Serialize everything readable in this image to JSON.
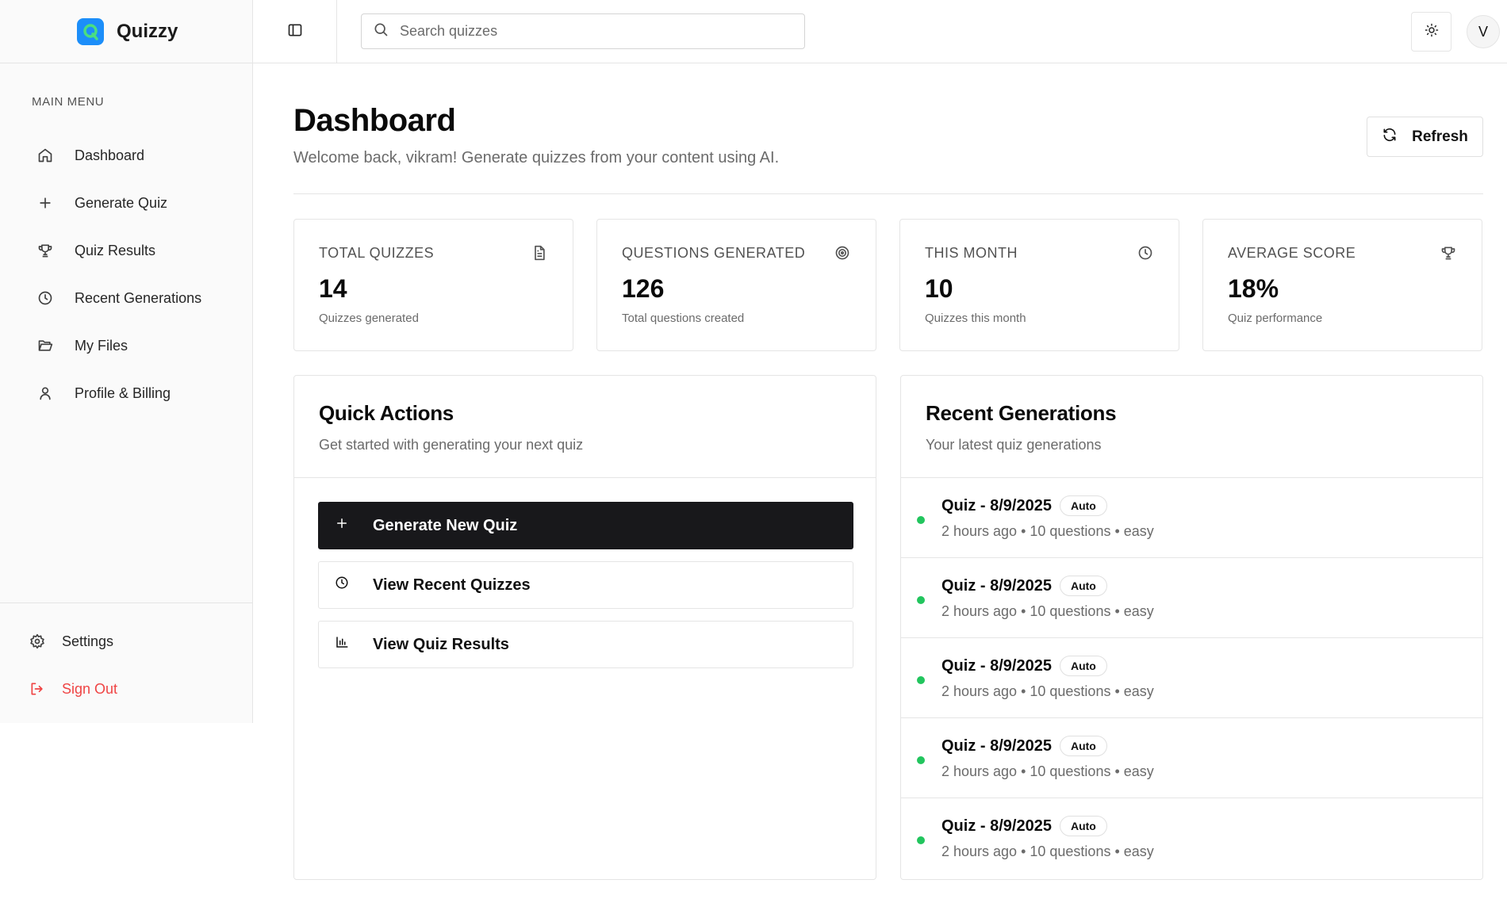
{
  "brand": {
    "name": "Quizzy",
    "logo_letter": "Q"
  },
  "search": {
    "placeholder": "Search quizzes",
    "value": ""
  },
  "user": {
    "avatar_initial": "V"
  },
  "sidebar": {
    "heading": "MAIN MENU",
    "items": [
      {
        "label": "Dashboard",
        "icon": "home-icon"
      },
      {
        "label": "Generate Quiz",
        "icon": "plus-icon"
      },
      {
        "label": "Quiz Results",
        "icon": "trophy-icon"
      },
      {
        "label": "Recent Generations",
        "icon": "clock-icon"
      },
      {
        "label": "My Files",
        "icon": "folder-open-icon"
      },
      {
        "label": "Profile & Billing",
        "icon": "user-icon"
      }
    ],
    "bottom": {
      "settings_label": "Settings",
      "signout_label": "Sign Out"
    }
  },
  "header": {
    "title": "Dashboard",
    "subtitle": "Welcome back, vikram! Generate quizzes from your content using AI.",
    "refresh_label": "Refresh"
  },
  "stats": [
    {
      "label": "TOTAL QUIZZES",
      "value": "14",
      "desc": "Quizzes generated",
      "icon": "file-text-icon"
    },
    {
      "label": "QUESTIONS GENERATED",
      "value": "126",
      "desc": "Total questions created",
      "icon": "target-icon"
    },
    {
      "label": "THIS MONTH",
      "value": "10",
      "desc": "Quizzes this month",
      "icon": "clock-icon"
    },
    {
      "label": "AVERAGE SCORE",
      "value": "18%",
      "desc": "Quiz performance",
      "icon": "trophy-icon"
    }
  ],
  "quick_actions": {
    "title": "Quick Actions",
    "subtitle": "Get started with generating your next quiz",
    "buttons": [
      {
        "label": "Generate New Quiz",
        "icon": "plus-icon"
      },
      {
        "label": "View Recent Quizzes",
        "icon": "clock-icon"
      },
      {
        "label": "View Quiz Results",
        "icon": "bar-chart-icon"
      }
    ]
  },
  "recent": {
    "title": "Recent Generations",
    "subtitle": "Your latest quiz generations",
    "items": [
      {
        "title": "Quiz - 8/9/2025",
        "badge": "Auto",
        "meta": "2 hours ago • 10 questions • easy"
      },
      {
        "title": "Quiz - 8/9/2025",
        "badge": "Auto",
        "meta": "2 hours ago • 10 questions • easy"
      },
      {
        "title": "Quiz - 8/9/2025",
        "badge": "Auto",
        "meta": "2 hours ago • 10 questions • easy"
      },
      {
        "title": "Quiz - 8/9/2025",
        "badge": "Auto",
        "meta": "2 hours ago • 10 questions • easy"
      },
      {
        "title": "Quiz - 8/9/2025",
        "badge": "Auto",
        "meta": "2 hours ago • 10 questions • easy"
      }
    ]
  },
  "colors": {
    "accent": "#18181b",
    "brand": "#1c8ef9",
    "logo_inner": "#4ade80",
    "status_dot": "#22c55e",
    "danger": "#ef4444"
  }
}
